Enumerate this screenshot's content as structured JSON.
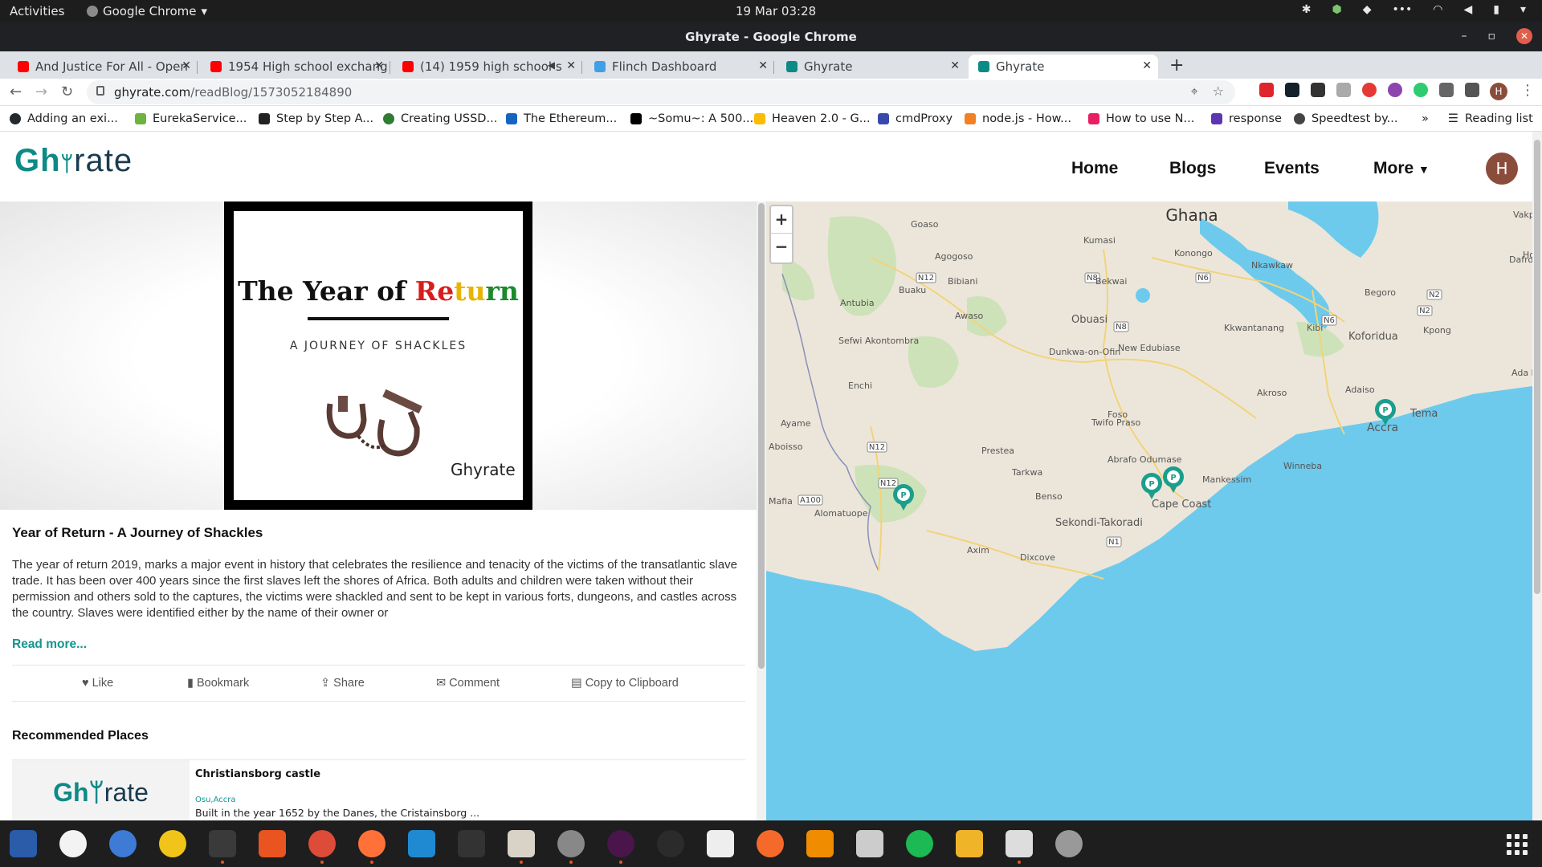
{
  "system_bar": {
    "activities": "Activities",
    "app_name": "Google Chrome",
    "datetime": "19 Mar  03:28"
  },
  "window": {
    "title": "Ghyrate - Google Chrome"
  },
  "tabs": [
    {
      "label": "And Justice For All - Open",
      "icon": "youtube-icon",
      "color": "#ff0000"
    },
    {
      "label": "1954 High school exchang",
      "icon": "youtube-icon",
      "color": "#ff0000"
    },
    {
      "label": "(14) 1959 high school s",
      "icon": "youtube-icon",
      "color": "#ff0000"
    },
    {
      "label": "Flinch Dashboard",
      "icon": "flinch-icon",
      "color": "#3fa0e8"
    },
    {
      "label": "Ghyrate",
      "icon": "ghyrate-icon",
      "color": "#0e8a86"
    },
    {
      "label": "Ghyrate",
      "icon": "ghyrate-icon",
      "color": "#0e8a86"
    }
  ],
  "address_bar": {
    "host": "ghyrate.com",
    "path": "/readBlog/1573052184890"
  },
  "bookmarks": [
    {
      "label": "Adding an exi...",
      "color": "#24292e"
    },
    {
      "label": "EurekaService...",
      "color": "#6db33f"
    },
    {
      "label": "Step by Step A...",
      "color": "#222222"
    },
    {
      "label": "Creating USSD...",
      "color": "#2e7d32"
    },
    {
      "label": "The Ethereum...",
      "color": "#1565c0"
    },
    {
      "label": "~Somu~: A 500...",
      "color": "#000000"
    },
    {
      "label": "Heaven 2.0 - G...",
      "color": "#fbbc04"
    },
    {
      "label": "cmdProxy",
      "color": "#3949ab"
    },
    {
      "label": "node.js - How...",
      "color": "#f48024"
    },
    {
      "label": "How to use N...",
      "color": "#e91e63"
    },
    {
      "label": "response",
      "color": "#5e35b1"
    },
    {
      "label": "Speedtest by...",
      "color": "#444444"
    }
  ],
  "reading_list": "Reading list",
  "site": {
    "logo_prefix": "Gh",
    "logo_suffix": "rate",
    "nav": [
      "Home",
      "Blogs",
      "Events",
      "More"
    ],
    "profile_initial": "H"
  },
  "poster": {
    "title_part1": "The Year of ",
    "title_part2": "Return",
    "subtitle": "A JOURNEY OF SHACKLES",
    "logo": "Ghyrate"
  },
  "article": {
    "title": "Year of Return - A Journey of Shackles",
    "body": "The year of return 2019, marks a major event in history that celebrates the resilience and tenacity of the victims of the transatlantic slave trade. It has been over 400 years since the first slaves left the shores of Africa. Both adults and children were taken without their permission and others sold to the captures, the victims were shackled and sent to be kept in various forts, dungeons, and castles across the country. Slaves were identified either by the name of their owner or",
    "read_more": "Read more...",
    "actions": [
      "Like",
      "Bookmark",
      "Share",
      "Comment",
      "Copy to Clipboard"
    ]
  },
  "recommended": {
    "heading": "Recommended Places",
    "items": [
      {
        "title": "Christiansborg castle",
        "location": "Osu,Accra",
        "desc": "Built in the year 1652 by the Danes, the Cristainsborg ..."
      }
    ]
  },
  "map": {
    "country": "Ghana",
    "zoom_in": "+",
    "zoom_out": "−",
    "places": [
      "Vakpo",
      "Goaso",
      "Kumasi",
      "Konongo",
      "Nkawkaw",
      "Agogoso",
      "Bibiani",
      "Bekwai",
      "Dafror",
      "Ho",
      "Buaku",
      "Begoro",
      "Antubia",
      "Awaso",
      "Obuasi",
      "Koforidua",
      "Kpong",
      "Sefwi Akontombra",
      "Kkwantanang",
      "Kibi",
      "New Edubiase",
      "Dunkwa-on-Ofin",
      "Ada K",
      "Enchi",
      "Akroso",
      "Adaiso",
      "Foso",
      "Tema",
      "Ayame",
      "Twifo Praso",
      "Accra",
      "Aboisso",
      "Prestea",
      "Abrafo Odumase",
      "Winneba",
      "Tarkwa",
      "Mankessim",
      "Mafia",
      "Alomatuope",
      "Benso",
      "Cape Coast",
      "Sekondi-Takoradi",
      "Axim",
      "Dixcove"
    ],
    "roads": [
      "N12",
      "N8",
      "N6",
      "N2",
      "N8",
      "N6",
      "N2",
      "N12",
      "N12",
      "A100",
      "N1"
    ]
  }
}
